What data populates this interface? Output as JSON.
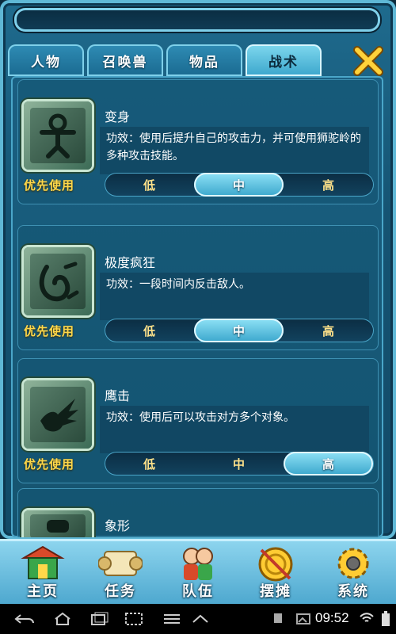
{
  "tabs": [
    {
      "label": "人物",
      "active": false
    },
    {
      "label": "召唤兽",
      "active": false
    },
    {
      "label": "物品",
      "active": false
    },
    {
      "label": "战术",
      "active": true
    }
  ],
  "close_icon": "close-x-icon",
  "priority_label": "优先使用",
  "priority_options": [
    "低",
    "中",
    "高"
  ],
  "skills": [
    {
      "name": "变身",
      "desc": "功效：使用后提升自己的攻击力，并可使用狮驼岭的多种攻击技能。",
      "icon": "transform-figure-icon",
      "selected": "中"
    },
    {
      "name": "极度疯狂",
      "desc": "功效：一段时间内反击敌人。",
      "icon": "frenzy-icon",
      "selected": "中"
    },
    {
      "name": "鹰击",
      "desc": "功效：使用后可以攻击对方多个对象。",
      "icon": "eagle-icon",
      "selected": "高"
    },
    {
      "name": "象形",
      "desc": "",
      "icon": "elephant-icon",
      "selected": ""
    }
  ],
  "bottom_nav": [
    {
      "label": "主页",
      "icon": "home-pagoda-icon"
    },
    {
      "label": "任务",
      "icon": "scroll-icon"
    },
    {
      "label": "队伍",
      "icon": "team-icon"
    },
    {
      "label": "摆摊",
      "icon": "stall-coin-icon"
    },
    {
      "label": "系统",
      "icon": "gear-icon"
    }
  ],
  "status_bar": {
    "time": "09:52"
  },
  "colors": {
    "accent_gold": "#ffd84a",
    "panel_blue": "#1a5f82",
    "selected_cyan": "#8fe2f6"
  }
}
